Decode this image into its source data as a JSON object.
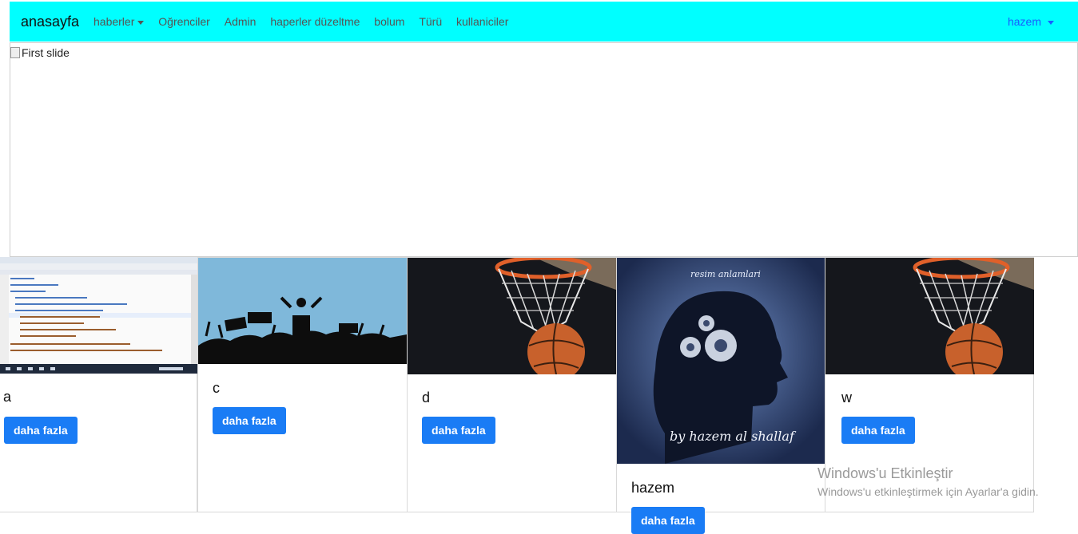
{
  "navbar": {
    "brand": "anasayfa",
    "links": [
      {
        "label": "haberler",
        "dropdown": true
      },
      {
        "label": "Oğrenciler"
      },
      {
        "label": "Admin"
      },
      {
        "label": "haperler düzeltme"
      },
      {
        "label": "bolum"
      },
      {
        "label": "Türü"
      },
      {
        "label": "kullaniciler"
      }
    ],
    "user": "hazem",
    "background": "#00ffff"
  },
  "carousel": {
    "alt_text": "First slide"
  },
  "cards": [
    {
      "title": "a",
      "button": "daha fazla",
      "image": "code-editor-screenshot"
    },
    {
      "title": "c",
      "button": "daha fazla",
      "image": "protest-crowd-silhouette"
    },
    {
      "title": "d",
      "button": "daha fazla",
      "image": "basketball-hoop"
    },
    {
      "title": "hazem",
      "button": "daha fazla",
      "image": "head-with-gears"
    },
    {
      "title": "w",
      "button": "daha fazla",
      "image": "basketball-hoop"
    }
  ],
  "images": {
    "hazem_top_text": "resim anlamlari",
    "hazem_bottom_text": "by hazem al shallaf"
  },
  "watermark": {
    "line1": "Windows'u Etkinleştir",
    "line2": "Windows'u etkinleştirmek için Ayarlar'a gidin."
  }
}
